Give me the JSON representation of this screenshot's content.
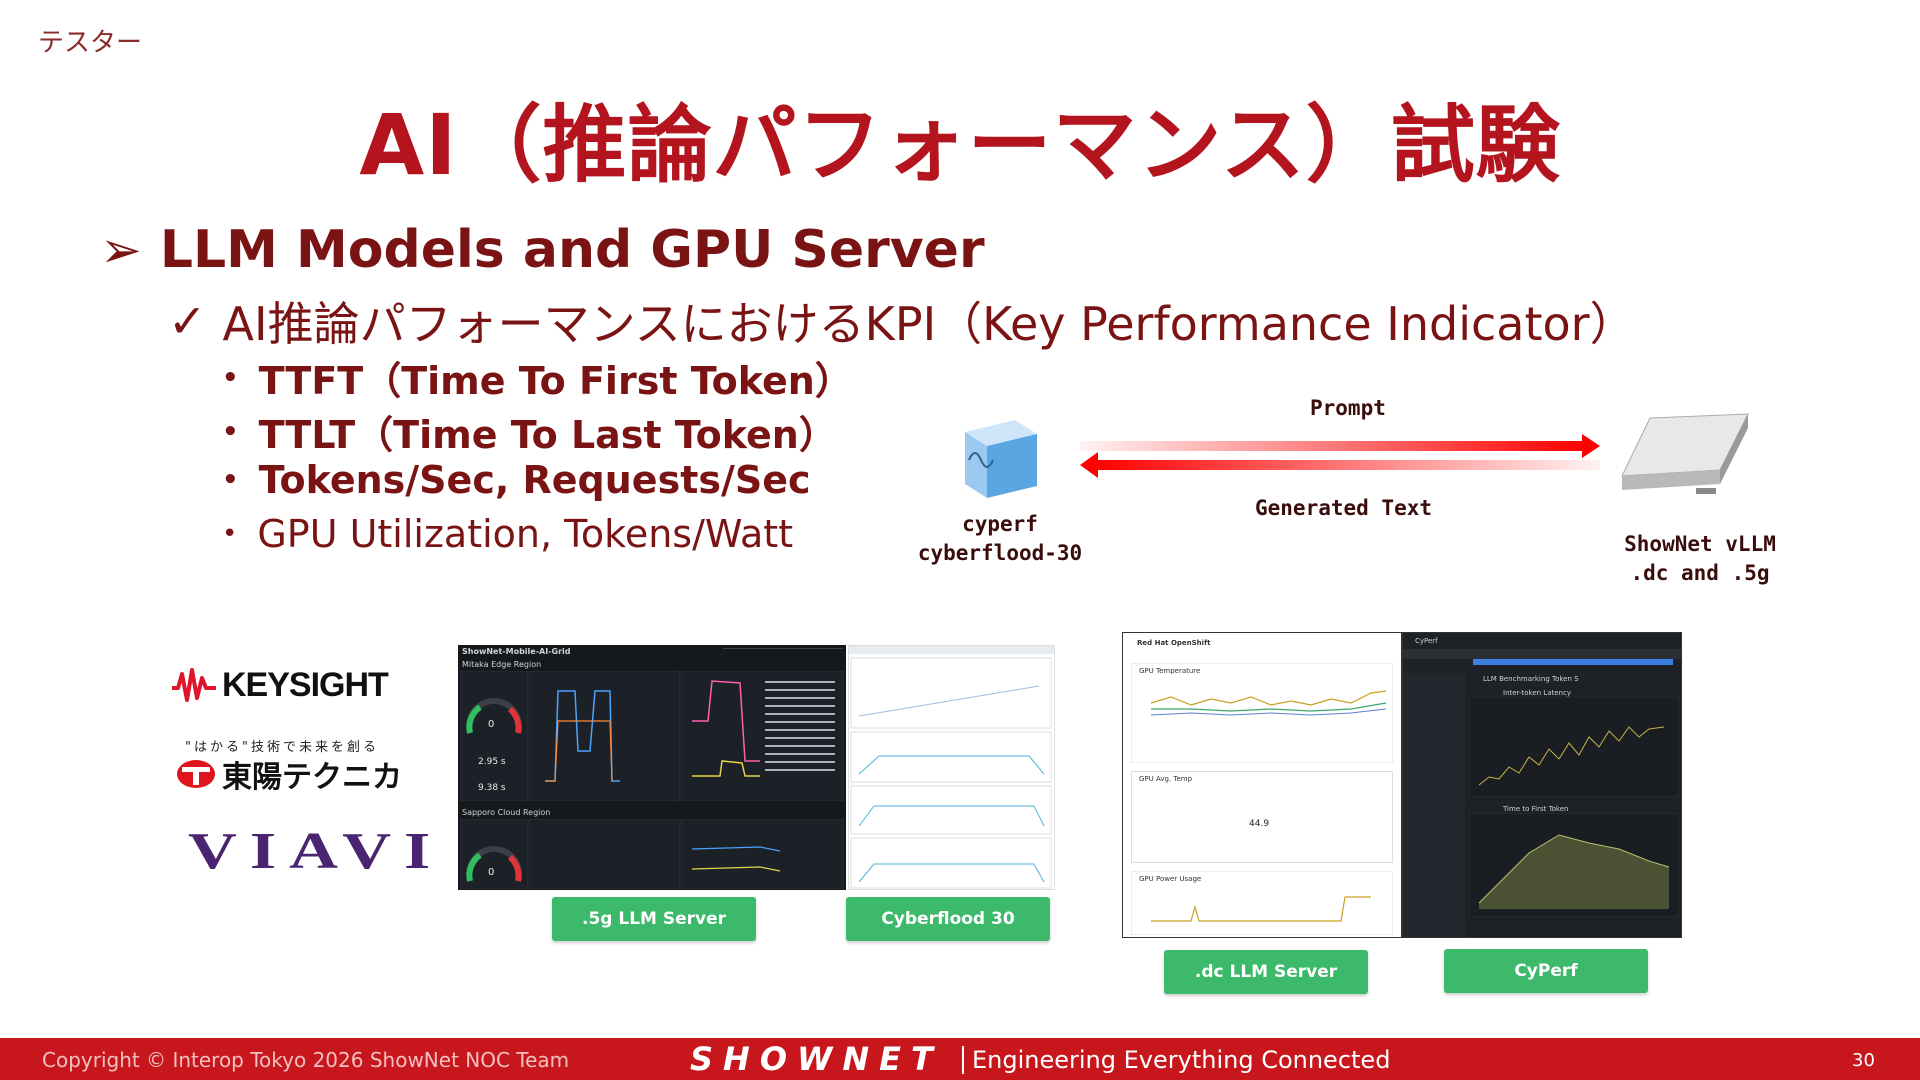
{
  "header": {
    "corner_label": "テスター",
    "title": "AI（推論パフォーマンス）試験"
  },
  "content": {
    "heading": "LLM Models and GPU Server",
    "subheading": "AI推論パフォーマンスにおけるKPI（Key Performance Indicator）",
    "bullets": [
      "TTFT（Time To First Token）",
      "TTLT（Time To Last Token）",
      "Tokens/Sec, Requests/Sec",
      "GPU Utilization, Tokens/Watt"
    ]
  },
  "diagram": {
    "prompt_label": "Prompt",
    "generated_label": "Generated Text",
    "client_name": "cyperf",
    "client_host": "cyberflood-30",
    "server_name": "ShowNet vLLM",
    "server_sites": ".dc and .5g",
    "colors": {
      "arrow": "#ff0000",
      "client_cube": "#7fb8e8",
      "server": "#c9c9c9"
    }
  },
  "logos": {
    "keysight": "KEYSIGHT",
    "toyo_tagline": "\"はかる\"技術で未来を創る",
    "toyo": "東陽テクニカ",
    "viavi": "VIAVI"
  },
  "screenshots": {
    "grafana": {
      "dashboard_title": "ShowNet-Mobile-AI-Grid",
      "region1": "Mitaka Edge Region",
      "region2": "Sapporo Cloud Region",
      "gauge1_value": "0",
      "gauge2_value": "0",
      "stat1": "2.95 s",
      "stat2": "9.38 s"
    },
    "openshift": {
      "brand": "Red Hat OpenShift",
      "panel1": "GPU Temperature",
      "panel2": "GPU Avg. Temp",
      "panel2_value": "44.9",
      "panel3": "GPU Power Usage"
    },
    "cyperf": {
      "brand": "CyPerf",
      "tab": "LLM Benchmarking Token S",
      "chart1": "Inter-token Latency",
      "chart2": "Time to First Token"
    }
  },
  "buttons": {
    "g5_server": ".5g LLM Server",
    "cyberflood": "Cyberflood 30",
    "dc_server": ".dc LLM Server",
    "cyperf": "CyPerf"
  },
  "footer": {
    "copyright": "Copyright © Interop Tokyo 2026 ShowNet NOC Team",
    "logo": "SHOWNET",
    "tagline": "Engineering Everything Connected",
    "page": "30"
  }
}
